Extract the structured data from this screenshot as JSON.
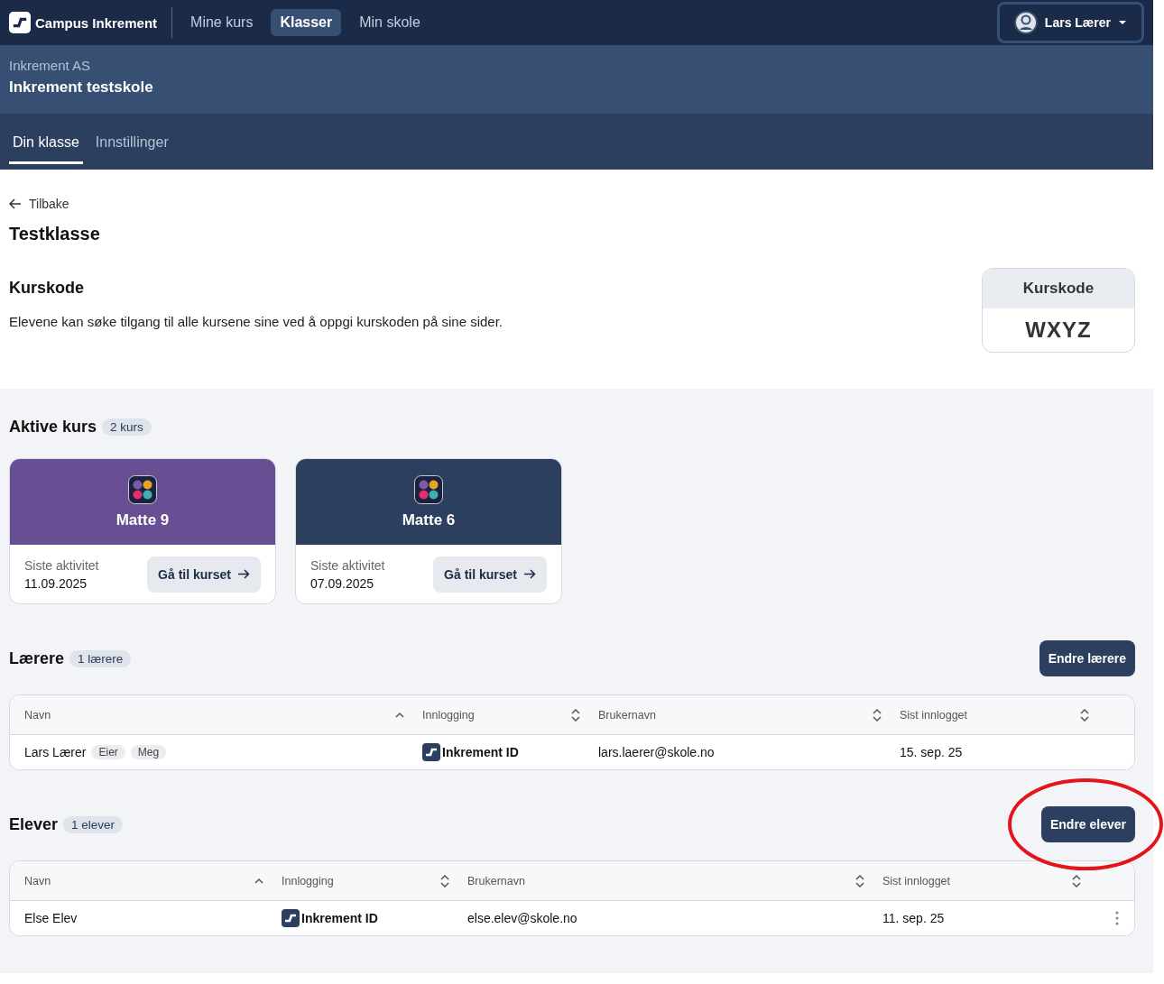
{
  "topbar": {
    "brand": "Campus Inkrement",
    "nav": [
      {
        "label": "Mine kurs",
        "selected": false
      },
      {
        "label": "Klasser",
        "selected": true
      },
      {
        "label": "Min skole",
        "selected": false
      }
    ],
    "user": "Lars Lærer"
  },
  "org": {
    "company": "Inkrement AS",
    "school": "Inkrement testskole"
  },
  "tabs": [
    {
      "label": "Din klasse",
      "selected": true
    },
    {
      "label": "Innstillinger",
      "selected": false
    }
  ],
  "back": "Tilbake",
  "title": "Testklasse",
  "code_section": {
    "heading": "Kurskode",
    "text": "Elevene kan søke tilgang til alle kursene sine ved å oppgi kurskoden på sine sider.",
    "box_label": "Kurskode",
    "code": "WXYZ"
  },
  "courses": {
    "heading": "Aktive kurs",
    "count": "2 kurs",
    "items": [
      {
        "name": "Matte 9",
        "color": "#684f94",
        "activity_label": "Siste aktivitet",
        "date": "11.09.2025",
        "button": "Gå til kurset"
      },
      {
        "name": "Matte 6",
        "color": "#2c3f5f",
        "activity_label": "Siste aktivitet",
        "date": "07.09.2025",
        "button": "Gå til kurset"
      }
    ]
  },
  "tables": [
    {
      "heading": "Lærere",
      "count": "1 lærere",
      "button": "Endre lærere",
      "columns": [
        {
          "label": "Navn",
          "sorted": true
        },
        {
          "label": "Innlogging",
          "sorted": false
        },
        {
          "label": "Brukernavn",
          "sorted": false
        },
        {
          "label": "Sist innlogget",
          "sorted": false
        }
      ],
      "rows": [
        {
          "name": "Lars Lærer",
          "tags": [
            "Eier",
            "Meg"
          ],
          "login": "Inkrement ID",
          "username": "lars.laerer@skole.no",
          "last": "15. sep. 25",
          "menu": false
        }
      ],
      "annotated": false
    },
    {
      "heading": "Elever",
      "count": "1 elever",
      "button": "Endre elever",
      "columns": [
        {
          "label": "Navn",
          "sorted": true
        },
        {
          "label": "Innlogging",
          "sorted": false
        },
        {
          "label": "Brukernavn",
          "sorted": false
        },
        {
          "label": "Sist innlogget",
          "sorted": false
        }
      ],
      "rows": [
        {
          "name": "Else Elev",
          "tags": [],
          "login": "Inkrement ID",
          "username": "else.elev@skole.no",
          "last": "11. sep. 25",
          "menu": true
        }
      ],
      "annotated": true
    }
  ]
}
